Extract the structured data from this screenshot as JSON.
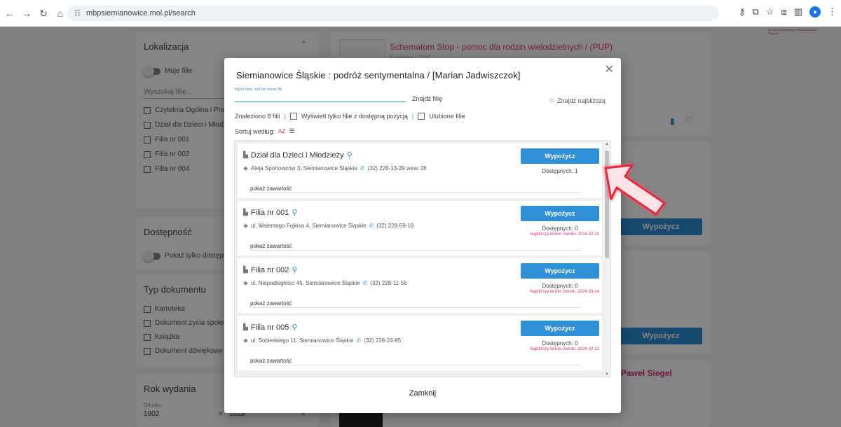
{
  "browser": {
    "url": "mbpsiemianowice.mol.pl/search"
  },
  "header_logo_text": "im. Anny Szcześniej w Siemianowicach Śląskich",
  "filters": {
    "location": {
      "title": "Lokalizacja",
      "my_branches": "Moje filie",
      "search_placeholder": "Wyszukaj filię...",
      "items": [
        "Czytelnia Ogólna i Prasy",
        "Dział dla Dzieci i Młodzież",
        "Filia nr 001",
        "Filia nr 002",
        "Filia nr 004"
      ]
    },
    "availability": {
      "title": "Dostępność",
      "toggle_label": "Pokaż tylko dostępne"
    },
    "doc_type": {
      "title": "Typ dokumentu",
      "items": [
        "Kartoteka",
        "Dokument życia społeczne",
        "Książka",
        "Dokument dźwiękowy"
      ]
    },
    "year": {
      "title": "Rok wydania",
      "from_label": "Od roku",
      "from_value": "1902",
      "to_value": "2023"
    }
  },
  "results": {
    "first_title": "Schematom Stop - pomoc dla rodzin wielodzietnych / (PUP)",
    "first_meta": "Kartoteka | 2015",
    "borrow_label": "Wypożycz",
    "author_fragment": "Paweł Siegel"
  },
  "modal": {
    "title": "Siemianowice Śląskie : podróż sentymentalna / [Marian Jadwiszczok]",
    "search_hint": "Wpisz ulicę, kod lub nazwę filii",
    "find_branch": "Znajdź filię",
    "find_nearest": "Znajdź najbliższą",
    "found_text": "Znaleziono 8 filii",
    "only_available": "Wyświetl tylko filie z dostępną pozycją",
    "favorites": "Ulubione filie",
    "sort_label": "Sortuj według:",
    "sort_value": "AZ",
    "close_label": "Zamknij",
    "branches": [
      {
        "name": "Dział dla Dzieci i Młodzieży",
        "address": "Aleja Sportowców 3, Siemianowice Śląskie",
        "phone": "(32) 228-13-29 wew. 28",
        "button": "Wypożycz",
        "available": "Dostępnych: 1",
        "return_date": "",
        "more": "pokaż zawartość"
      },
      {
        "name": "Filia nr 001",
        "address": "ul. Walentego Fojkisa 4, Siemianowice Śląskie",
        "phone": "(32) 228-59-19",
        "button": "Wypożycz",
        "available": "Dostępnych: 0",
        "return_date": "Najbliższy termin zwrotu: 2024-02-12",
        "more": "pokaż zawartość"
      },
      {
        "name": "Filia nr 002",
        "address": "ul. Niepodległości 45, Siemianowice Śląskie",
        "phone": "(32) 228-11-56",
        "button": "Wypożycz",
        "available": "Dostępnych: 0",
        "return_date": "Najbliższy termin zwrotu: 2024-03-14",
        "more": "pokaż zawartość"
      },
      {
        "name": "Filia nr 005",
        "address": "ul. Sobieskiego 11, Siemianowice Śląskie",
        "phone": "(32) 228-24-85",
        "button": "Wypożycz",
        "available": "Dostępnych: 0",
        "return_date": "Najbliższy termin zwrotu: 2024-02-23",
        "more": "pokaż zawartość"
      }
    ]
  },
  "colors": {
    "accent_blue": "#2f8fd7",
    "accent_pink": "#e0307a",
    "annotation_arrow": "#e8283c"
  }
}
